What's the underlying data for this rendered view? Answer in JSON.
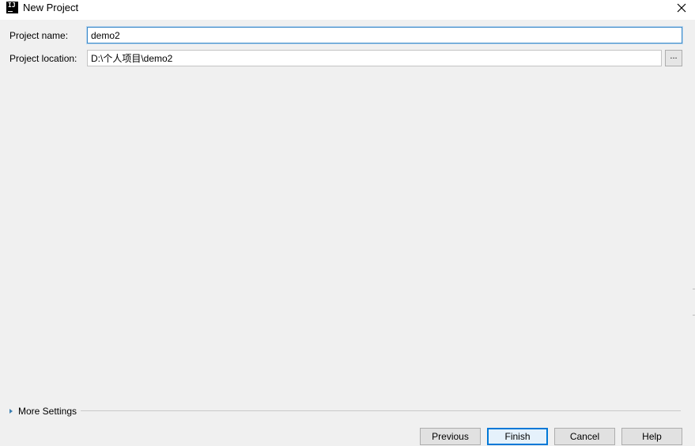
{
  "window": {
    "title": "New Project",
    "icon": "intellij-idea-icon",
    "icon_text": "IJ"
  },
  "form": {
    "project_name_label": "Project name:",
    "project_name_value": "demo2",
    "project_location_label": "Project location:",
    "project_location_value": "D:\\个人项目\\demo2",
    "browse_label": "..."
  },
  "more_settings": {
    "label": "More Settings",
    "expanded": false
  },
  "buttons": {
    "previous": "Previous",
    "finish": "Finish",
    "cancel": "Cancel",
    "help": "Help"
  },
  "colors": {
    "dialog_background": "#f0f0f0",
    "focus_border": "#3d8ac8",
    "default_button_border": "#0078d7"
  }
}
